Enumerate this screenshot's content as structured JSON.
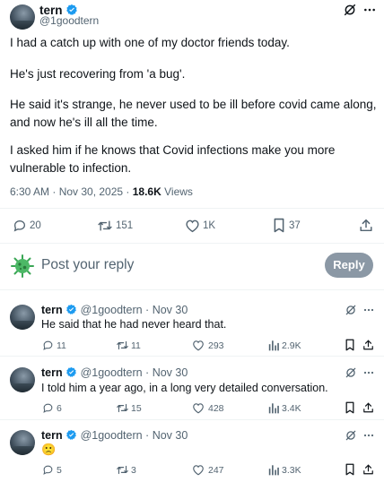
{
  "main_tweet": {
    "author_name": "tern",
    "handle": "@1goodtern",
    "paragraphs": [
      "I had a catch up with one of my doctor friends today.",
      "He's just recovering from 'a bug'.",
      "He said it's strange, he never used to be ill before covid came along, and now he's ill all the time.",
      "I asked him if he knows that Covid infections make you more vulnerable to infection."
    ],
    "timestamp": "6:30 AM · Nov 30, 2025 · ",
    "views_count": "18.6K",
    "views_label": " Views",
    "replies": "20",
    "reposts": "151",
    "likes": "1K",
    "bookmarks": "37"
  },
  "composer": {
    "placeholder": "Post your reply",
    "button_label": "Reply"
  },
  "replies": [
    {
      "author_name": "tern",
      "meta": "@1goodtern · Nov 30",
      "text": "He said that he had never heard that.",
      "replies": "11",
      "reposts": "11",
      "likes": "293",
      "views": "2.9K"
    },
    {
      "author_name": "tern",
      "meta": "@1goodtern · Nov 30",
      "text": "I told him a year ago, in a long very detailed conversation.",
      "replies": "6",
      "reposts": "15",
      "likes": "428",
      "views": "3.4K"
    },
    {
      "author_name": "tern",
      "meta": "@1goodtern · Nov 30",
      "text": "🙁",
      "replies": "5",
      "reposts": "3",
      "likes": "247",
      "views": "3.3K"
    }
  ],
  "colors": {
    "accent": "#1d9bf0",
    "muted": "#536471",
    "reply_button": "#8b98a5",
    "virus_icon": "#3aa655"
  }
}
